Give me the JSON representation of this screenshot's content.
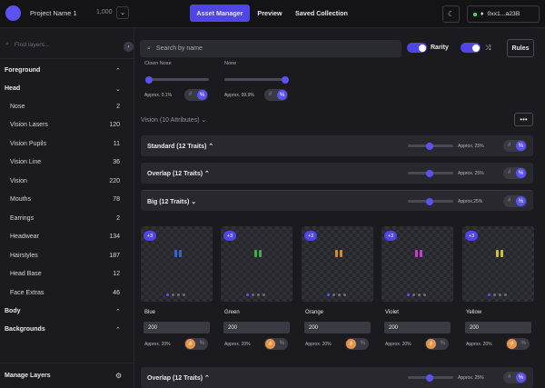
{
  "topbar": {
    "project_name": "Project Name 1",
    "project_count": "1,000",
    "tabs": [
      "Asset Manager",
      "Preview",
      "Saved Collection"
    ],
    "wallet": "0xx1...a23B"
  },
  "sidebar": {
    "search_placeholder": "Find layers...",
    "groups": {
      "foreground": "Foreground",
      "head": "Head",
      "body": "Body",
      "backgrounds": "Backgrounds"
    },
    "items": [
      {
        "label": "Nose",
        "count": "2"
      },
      {
        "label": "Vision Lasers",
        "count": "120"
      },
      {
        "label": "Vision Pupils",
        "count": "11"
      },
      {
        "label": "Vision Line",
        "count": "36"
      },
      {
        "label": "Vision",
        "count": "220"
      },
      {
        "label": "Mouths",
        "count": "78"
      },
      {
        "label": "Earrings",
        "count": "2"
      },
      {
        "label": "Headwear",
        "count": "134"
      },
      {
        "label": "Hairstyles",
        "count": "187"
      },
      {
        "label": "Head Base",
        "count": "12"
      },
      {
        "label": "Face Extras",
        "count": "46"
      }
    ],
    "footer": "Manage Layers"
  },
  "main": {
    "search_placeholder": "Search by name",
    "rarity_label": "Rarity",
    "rules_label": "Rules",
    "top_traits": [
      {
        "name": "Clown Nose",
        "approx": "Approx. 0.1%"
      },
      {
        "name": "None",
        "approx": "Approx. 99.9%"
      }
    ],
    "hash": "#",
    "pct": "%",
    "vision_heading": "Vision (10 Attributes)",
    "groups": [
      {
        "title": "Standard (12 Traits)",
        "approx": "Approx. 25%"
      },
      {
        "title": "Overlap (12 Traits)",
        "approx": "Approx. 25%"
      },
      {
        "title": "Big (12 Traits)",
        "approx": "Approx.25%"
      },
      {
        "title": "Overlap (12 Traits)",
        "approx": "Approx. 25%"
      }
    ],
    "cards": [
      {
        "badge": "+3",
        "name": "Blue",
        "value": "200",
        "approx": "Approx. 20%",
        "color": "#3d5fd0"
      },
      {
        "badge": "+3",
        "name": "Green",
        "value": "200",
        "approx": "Approx. 20%",
        "color": "#3fae4a"
      },
      {
        "badge": "+3",
        "name": "Orange",
        "value": "200",
        "approx": "Approx. 20%",
        "color": "#d8892e"
      },
      {
        "badge": "+3",
        "name": "Violet",
        "value": "200",
        "approx": "Approx. 20%",
        "color": "#c23fd0"
      },
      {
        "badge": "+3",
        "name": "Yellow",
        "value": "200",
        "approx": "Approx. 20%",
        "color": "#d2c02e"
      }
    ]
  }
}
